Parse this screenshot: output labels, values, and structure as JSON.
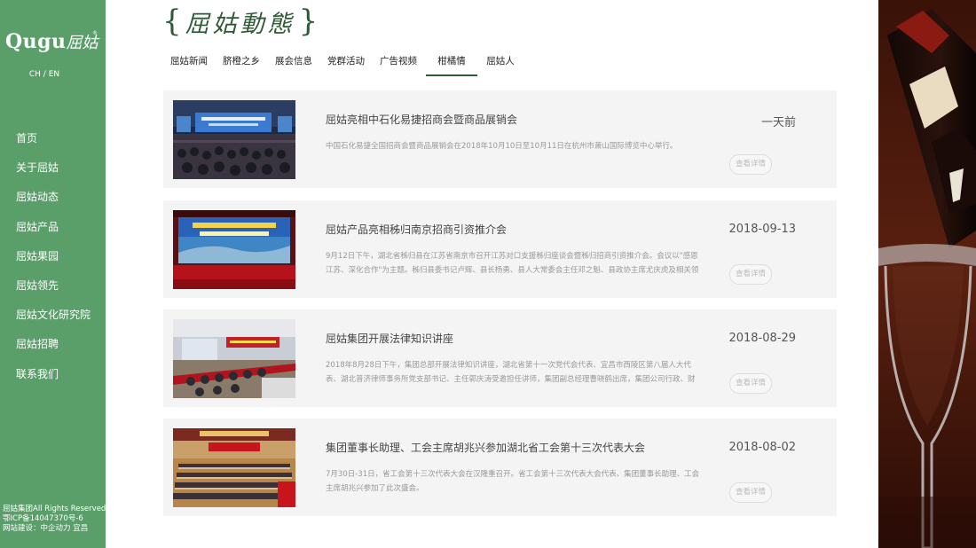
{
  "sidebar": {
    "logo_text": "Qugu",
    "logo_cn": "屈姑",
    "logo_reg": "®",
    "lang_ch": "CH",
    "lang_sep": " / ",
    "lang_en": "EN",
    "nav": [
      "首页",
      "关于屈姑",
      "屈姑动态",
      "屈姑产品",
      "屈姑果园",
      "屈姑领先",
      "屈姑文化研究院",
      "屈姑招聘",
      "联系我们"
    ],
    "footer": [
      "屈姑集团All Rights Reserved.",
      "鄂ICP备14047370号-6",
      "网站建设：中企动力 宜昌"
    ]
  },
  "heading": {
    "text": "屈姑動態",
    "brace_left": "{",
    "brace_right": "}"
  },
  "tabs": [
    {
      "label": "屈姑新闻"
    },
    {
      "label": "脐橙之乡"
    },
    {
      "label": "展会信息"
    },
    {
      "label": "党群活动"
    },
    {
      "label": "广告视频"
    },
    {
      "label": "柑橘情",
      "active": true
    },
    {
      "label": "屈姑人"
    }
  ],
  "news": [
    {
      "title": "屈姑亮相中石化易捷招商会暨商品展销会",
      "date": "一天前",
      "summary": "中国石化易捷全国招商会暨商品展销会在2018年10月10日至10月11日在杭州市萧山国际博览中心举行。",
      "button": "查看详情"
    },
    {
      "title": "屈姑产品亮相秭归南京招商引资推介会",
      "date": "2018-09-13",
      "summary": "9月12日下午，湖北省秭归县在江苏省南京市召开江苏对口支援秭归座谈会暨秭归招商引资推介会。会议以\"感恩江苏、深化合作\"为主题。秭归县委书记卢辉、县长杨勇、县人大常委会主任邓之魁、县政协主席尤庆虎及相关领导带",
      "button": "查看详情"
    },
    {
      "title": "屈姑集团开展法律知识讲座",
      "date": "2018-08-29",
      "summary": "2018年8月28日下午，集团总部开展法律知识讲座，湖北省第十一次党代会代表、宜昌市西陵区第八届人大代表、湖北普济律师事务所党支部书记、主任郭庆涛受邀担任讲师，集团副总经理曹晓鹤出席，集团公司行政、财务、销售等",
      "button": "查看详情"
    },
    {
      "title": "集团董事长助理、工会主席胡兆兴参加湖北省工会第十三次代表大会",
      "date": "2018-08-02",
      "summary": "7月30日-31日，省工会第十三次代表大会在汉隆重召开。省工会第十三次代表大会代表、集团董事长助理、工会主席胡兆兴参加了此次盛会。",
      "button": "查看详情"
    }
  ],
  "colors": {
    "sidebar": "#5a9e6a",
    "accent": "#2f5a37",
    "card": "#f4f4f4"
  }
}
